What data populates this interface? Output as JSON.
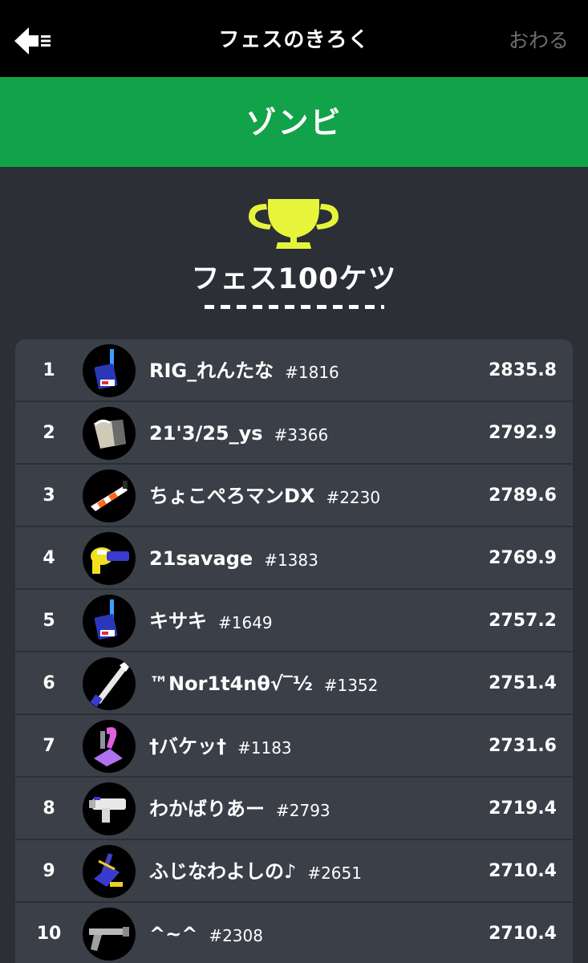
{
  "header": {
    "title": "フェスのきろく",
    "end_label": "おわる",
    "back_icon": "back-arrow-icon"
  },
  "team": {
    "name": "ゾンビ",
    "color": "#12a24a"
  },
  "ranking": {
    "title": "フェス100ケツ",
    "trophy_color": "#e6f53a",
    "trophy_icon": "trophy-icon",
    "entries": [
      {
        "rank": "1",
        "name": "RIG_れんたな",
        "id": "#1816",
        "power": "2835.8",
        "weapon_icon": "blue-brush-weapon-icon"
      },
      {
        "rank": "2",
        "name": "21'3/25_ys",
        "id": "#3366",
        "power": "2792.9",
        "weapon_icon": "bucket-weapon-icon"
      },
      {
        "rank": "3",
        "name": "ちょこぺろマンDX",
        "id": "#2230",
        "power": "2789.6",
        "weapon_icon": "orange-shooter-weapon-icon"
      },
      {
        "rank": "4",
        "name": "21savage",
        "id": "#1383",
        "power": "2769.9",
        "weapon_icon": "yellow-blaster-weapon-icon"
      },
      {
        "rank": "5",
        "name": "キサキ",
        "id": "#1649",
        "power": "2757.2",
        "weapon_icon": "blue-brush-weapon-icon"
      },
      {
        "rank": "6",
        "name": "™Nor1t4nθ√‾½",
        "id": "#1352",
        "power": "2751.4",
        "weapon_icon": "splatana-weapon-icon"
      },
      {
        "rank": "7",
        "name": "†バケッ†",
        "id": "#1183",
        "power": "2731.6",
        "weapon_icon": "purple-dualies-weapon-icon"
      },
      {
        "rank": "8",
        "name": "わかばりあー",
        "id": "#2793",
        "power": "2719.4",
        "weapon_icon": "white-roller-weapon-icon"
      },
      {
        "rank": "9",
        "name": "ふじなわよしの♪",
        "id": "#2651",
        "power": "2710.4",
        "weapon_icon": "purple-brush-weapon-icon"
      },
      {
        "rank": "10",
        "name": "^~^",
        "id": "#2308",
        "power": "2710.4",
        "weapon_icon": "grey-charger-weapon-icon"
      }
    ]
  }
}
